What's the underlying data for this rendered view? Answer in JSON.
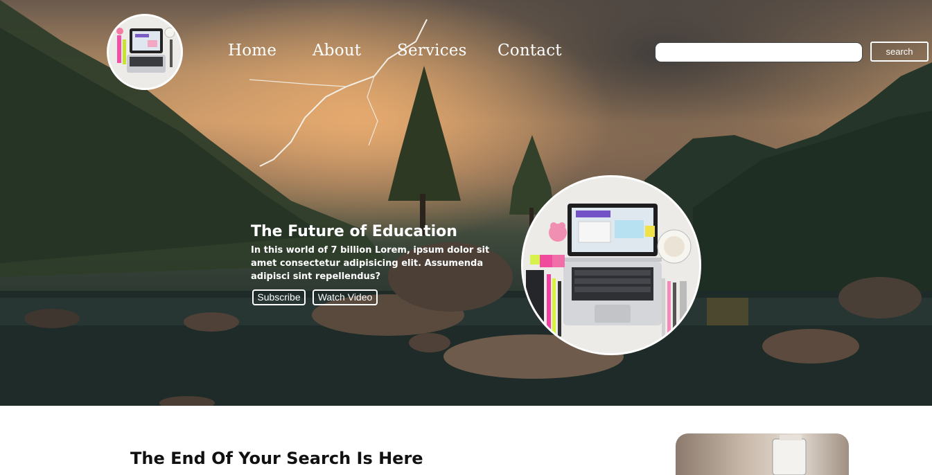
{
  "nav": {
    "items": [
      {
        "label": "Home"
      },
      {
        "label": "About"
      },
      {
        "label": "Services"
      },
      {
        "label": "Contact"
      }
    ]
  },
  "search": {
    "placeholder": "",
    "value": "",
    "button_label": "search"
  },
  "hero": {
    "title": "The Future of Education",
    "description": "In this world of 7 billion Lorem, ipsum dolor sit amet consectetur adipisicing elit. Assumenda adipisci sint repellendus?",
    "subscribe_label": "Subscribe",
    "watch_label": "Watch Video"
  },
  "section": {
    "heading": "The End Of Your Search Is Here"
  },
  "colors": {
    "text_on_hero": "#ffffff",
    "page_background": "#ffffff"
  }
}
